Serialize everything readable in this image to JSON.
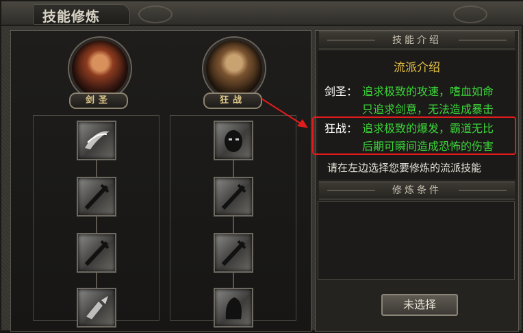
{
  "window": {
    "title": "技能修炼"
  },
  "classes": [
    {
      "name": "剑圣",
      "portrait": "swordsman-portrait",
      "skills": [
        "wind-slash-icon",
        "sword-icon",
        "sword-icon",
        "broken-blade-icon"
      ]
    },
    {
      "name": "狂战",
      "portrait": "berserker-portrait",
      "skills": [
        "rage-head-icon",
        "sword-icon",
        "sword-icon",
        "hooded-shadow-icon"
      ]
    }
  ],
  "intro": {
    "header": "技能介绍",
    "title": "流派介绍",
    "entries": [
      {
        "label": "剑圣：",
        "lines": [
          "追求极致的攻速，嗜血如命",
          "只追求剑意，无法造成暴击"
        ]
      },
      {
        "label": "狂战：",
        "lines": [
          "追求极致的爆发，霸道无比",
          "后期可瞬间造成恐怖的伤害"
        ]
      }
    ],
    "hint": "请在左边选择您要修炼的流派技能"
  },
  "conditions": {
    "header": "修炼条件"
  },
  "button": {
    "label": "未选择"
  },
  "colors": {
    "highlight": "#e21c1c",
    "desc_text": "#3bd639",
    "title_text": "#e6c146"
  }
}
